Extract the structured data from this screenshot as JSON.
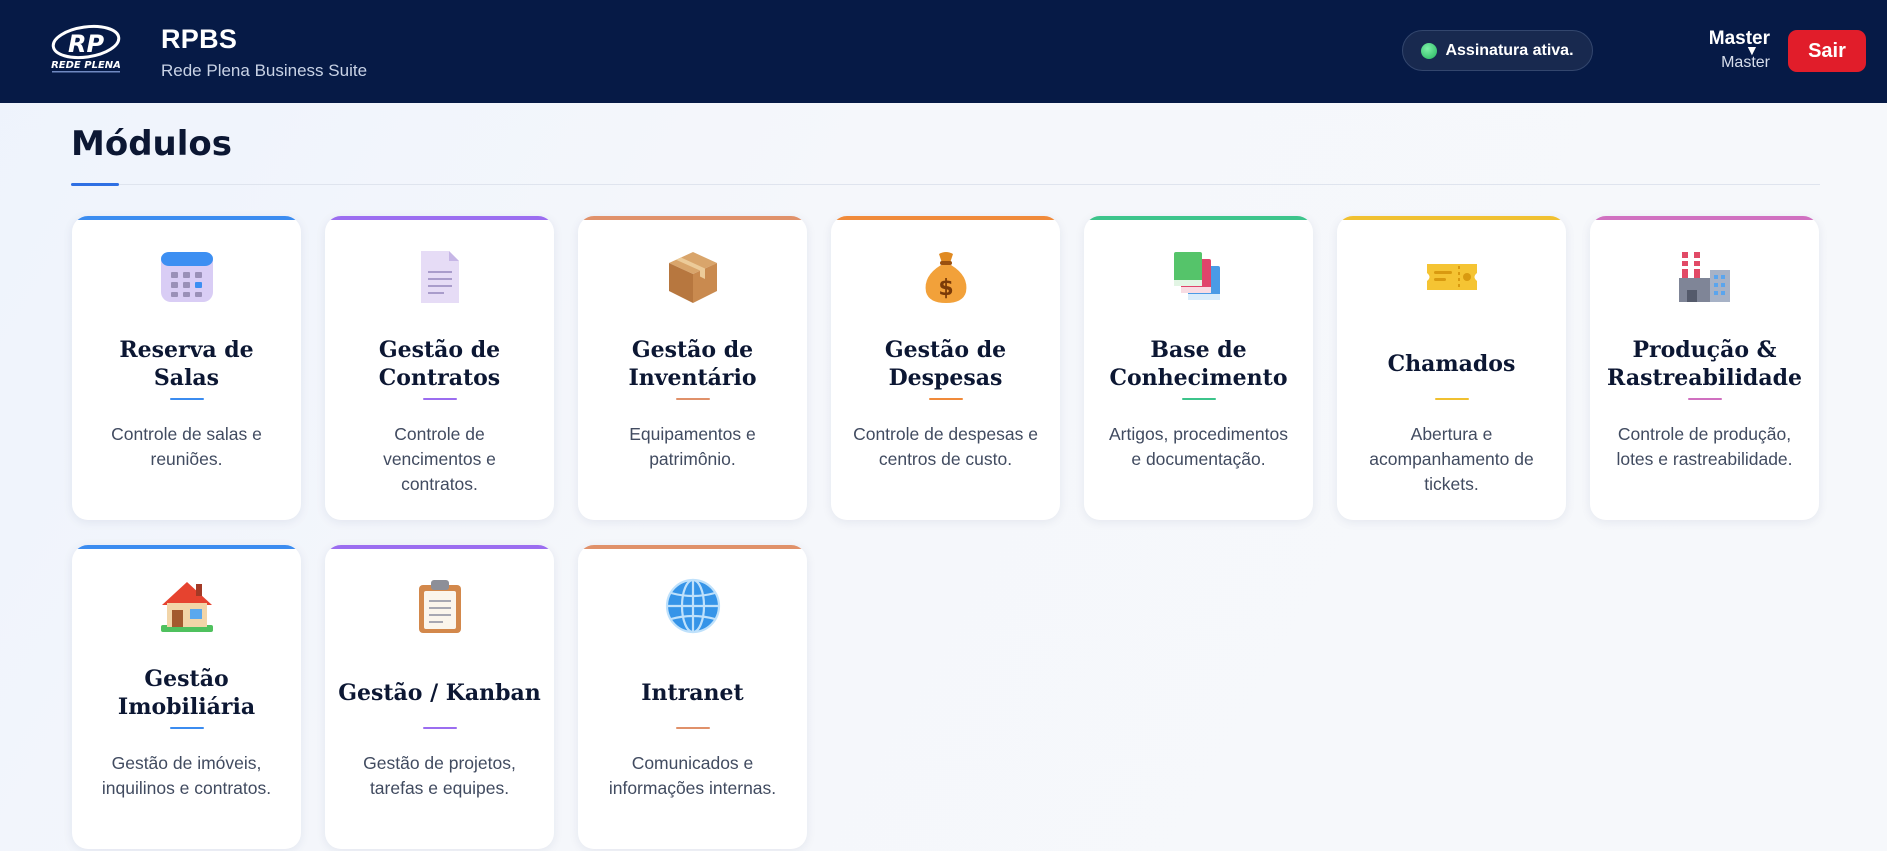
{
  "header": {
    "app_title": "RPBS",
    "app_subtitle": "Rede Plena Business Suite",
    "status_text": "Assinatura ativa.",
    "user_name": "Master",
    "user_role": "Master",
    "logout_label": "Sair",
    "logo_text": "REDE PLENA"
  },
  "main": {
    "section_title": "Módulos"
  },
  "colors": {
    "header_bg": "#061a46",
    "logout": "#e11d2a",
    "status_ok": "#23b45e"
  },
  "modules": [
    {
      "title": "Reserva de Salas",
      "desc": "Controle de salas e reuniões.",
      "icon": "calendar-icon",
      "accent": "#3b8cf0"
    },
    {
      "title": "Gestão de Contratos",
      "desc": "Controle de vencimentos e contratos.",
      "icon": "document-icon",
      "accent": "#9b6df0"
    },
    {
      "title": "Gestão de Inventário",
      "desc": "Equipamentos e patrimônio.",
      "icon": "box-icon",
      "accent": "#e0916a"
    },
    {
      "title": "Gestão de Despesas",
      "desc": "Controle de despesas e centros de custo.",
      "icon": "money-bag-icon",
      "accent": "#f08a3a"
    },
    {
      "title": "Base de Conhecimento",
      "desc": "Artigos, procedimentos e documentação.",
      "icon": "books-icon",
      "accent": "#3cc48b"
    },
    {
      "title": "Chamados",
      "desc": "Abertura e acompanhamento de tickets.",
      "icon": "ticket-icon",
      "accent": "#f0c030"
    },
    {
      "title": "Produção & Rastreabilidade",
      "desc": "Controle de produção, lotes e rastreabilidade.",
      "icon": "factory-icon",
      "accent": "#d070c0"
    },
    {
      "title": "Gestão Imobiliária",
      "desc": "Gestão de imóveis, inquilinos e contratos.",
      "icon": "house-icon",
      "accent": "#3b8cf0"
    },
    {
      "title": "Gestão / Kanban",
      "desc": "Gestão de projetos, tarefas e equipes.",
      "icon": "clipboard-icon",
      "accent": "#9b6df0"
    },
    {
      "title": "Intranet",
      "desc": "Comunicados e informações internas.",
      "icon": "globe-icon",
      "accent": "#e0916a"
    }
  ]
}
